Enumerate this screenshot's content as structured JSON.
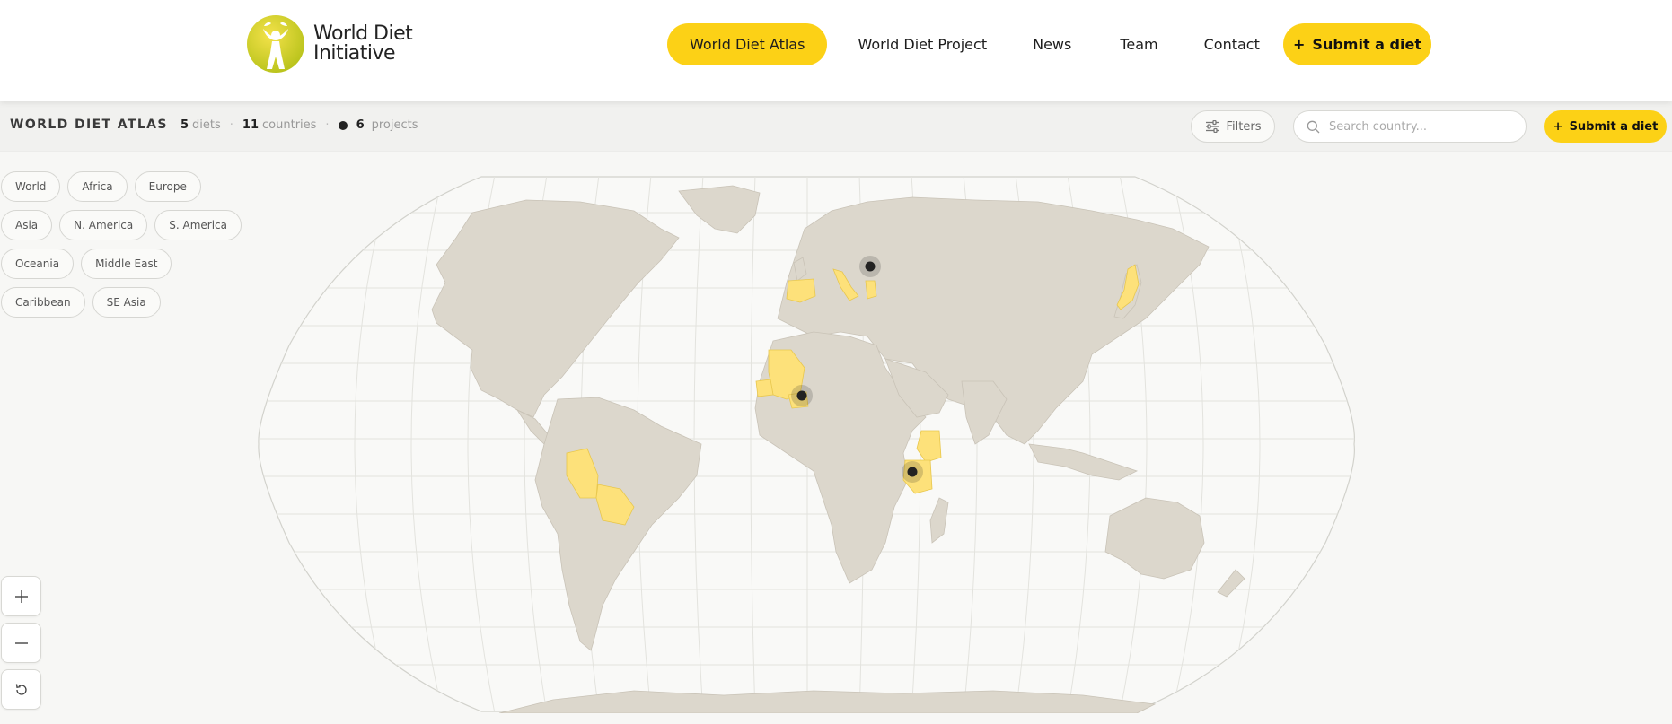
{
  "brand": {
    "line1": "World Diet",
    "line2": "Initiative",
    "accent": "#fcd116"
  },
  "nav": {
    "items": [
      {
        "label": "World Diet Atlas",
        "active": true
      },
      {
        "label": "World Diet Project",
        "active": false
      },
      {
        "label": "News",
        "active": false
      },
      {
        "label": "Team",
        "active": false
      },
      {
        "label": "Contact",
        "active": false
      }
    ],
    "cta": {
      "plus": "+",
      "label": "Submit a diet"
    }
  },
  "toolbar": {
    "title": "WORLD DIET ATLAS",
    "stats": {
      "diets_count": "5",
      "diets_label": "diets",
      "countries_count": "11",
      "countries_label": "countries",
      "projects_count": "6",
      "projects_label": "projects",
      "separator": "·"
    },
    "filters_label": "Filters",
    "search_placeholder": "Search country...",
    "cta": {
      "plus": "+",
      "label": "Submit a diet"
    }
  },
  "regions": [
    [
      "World",
      "Africa",
      "Europe"
    ],
    [
      "Asia",
      "N. America",
      "S. America"
    ],
    [
      "Oceania",
      "Middle East"
    ],
    [
      "Caribbean",
      "SE Asia"
    ]
  ],
  "map": {
    "land_color": "#dcd7cc",
    "highlight_color": "#fde17a",
    "marker_color": "#222222",
    "highlighted_countries": [
      "Spain",
      "Italy",
      "Greece",
      "Japan",
      "Mali",
      "Senegal",
      "Burkina Faso",
      "Kenya",
      "Tanzania",
      "Peru",
      "Bolivia"
    ],
    "project_markers": [
      "Serbia",
      "Burkina Faso",
      "Tanzania"
    ]
  },
  "controls": {
    "zoom_in_icon": "plus-icon",
    "zoom_out_icon": "minus-icon",
    "reset_icon": "reset-icon"
  }
}
